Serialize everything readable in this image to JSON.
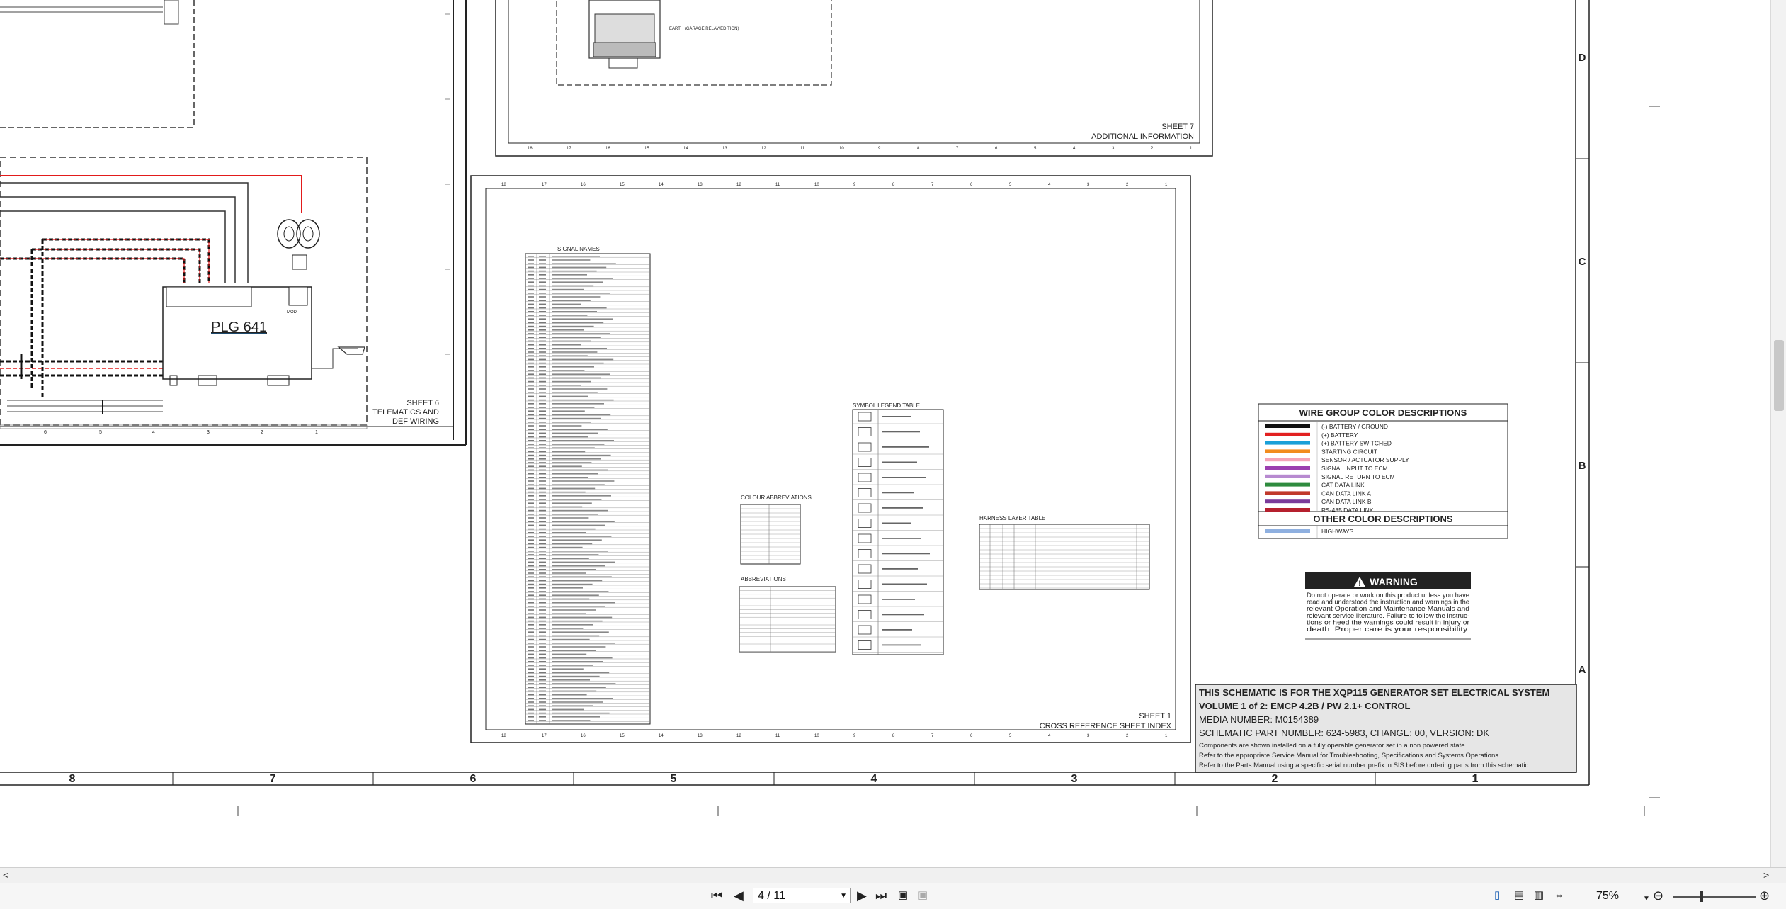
{
  "colors": {
    "wire_red": "#e21b1b",
    "link": "#1a73b8",
    "warning_bg": "#222222"
  },
  "plg": {
    "label": "PLG 641"
  },
  "sheet6": {
    "num": "SHEET 6",
    "line1": "TELEMATICS AND",
    "line2": "DEF WIRING"
  },
  "sheet7": {
    "num": "SHEET 7",
    "title": "ADDITIONAL INFORMATION"
  },
  "sheet1": {
    "num": "SHEET 1",
    "title": "CROSS REFERENCE SHEET INDEX"
  },
  "tables": {
    "signal_names": "SIGNAL NAMES",
    "colour_abbr": "COLOUR ABBREVIATIONS",
    "abbreviations": "ABBREVIATIONS",
    "symbol_legend": "SYMBOL LEGEND TABLE",
    "harness_layer": "HARNESS LAYER TABLE"
  },
  "wire_group": {
    "title": "WIRE GROUP COLOR DESCRIPTIONS",
    "items": [
      {
        "label": "(-) BATTERY / GROUND",
        "color": "#111111"
      },
      {
        "label": "(+) BATTERY",
        "color": "#e22020"
      },
      {
        "label": "(+) BATTERY SWITCHED",
        "color": "#1aa0d8"
      },
      {
        "label": "STARTING CIRCUIT",
        "color": "#f28c1e"
      },
      {
        "label": "SENSOR / ACTUATOR SUPPLY",
        "color": "#f4a3b8"
      },
      {
        "label": "SIGNAL INPUT TO ECM",
        "color": "#9b3fb0"
      },
      {
        "label": "SIGNAL RETURN TO ECM",
        "color": "#b78ad0"
      },
      {
        "label": "CAT DATA LINK",
        "color": "#2e8b3e"
      },
      {
        "label": "CAN DATA LINK A",
        "color": "#c0392b"
      },
      {
        "label": "CAN DATA LINK B",
        "color": "#7a3b9a"
      },
      {
        "label": "RS-485 DATA LINK",
        "color": "#b5202e"
      }
    ],
    "other_title": "OTHER COLOR DESCRIPTIONS",
    "other_items": [
      {
        "label": "HIGHWAYS",
        "color": "#8fb0e0"
      }
    ]
  },
  "warning": {
    "title": "WARNING",
    "lines": [
      "Do not operate or work on this product unless you have",
      "read and understood the instruction and warnings in the",
      "relevant Operation and Maintenance Manuals and",
      "relevant service literature. Failure to follow the instruc-",
      "tions or heed the warnings could result in injury or",
      "death. Proper care is your responsibility."
    ]
  },
  "title_block": {
    "line1": "THIS SCHEMATIC IS FOR THE XQP115 GENERATOR SET ELECTRICAL SYSTEM",
    "line2": "VOLUME 1 of 2: EMCP 4.2B / PW 2.1+ CONTROL",
    "line3": "MEDIA NUMBER: M0154389",
    "line4": "SCHEMATIC PART NUMBER: 624-5983, CHANGE: 00, VERSION: DK",
    "note1": "Components are shown installed on a fully operable generator set in a non powered state.",
    "note2": "Refer to the appropriate Service Manual for Troubleshooting, Specifications and Systems Operations.",
    "note3": "Refer to the Parts Manual using a specific serial number prefix in SIS before ordering parts from this schematic."
  },
  "grid": {
    "columns": [
      "8",
      "7",
      "6",
      "5",
      "4",
      "3",
      "2",
      "1"
    ],
    "rows": [
      "D",
      "C",
      "B",
      "A"
    ]
  },
  "viewer": {
    "page_value": "4 / 11",
    "zoom": "75%",
    "first": "⏮",
    "prev": "◀",
    "next": "▶",
    "last": "⏭",
    "scroll_left": "<",
    "scroll_right": ">",
    "zoom_out": "⊖",
    "zoom_in": "⊕"
  }
}
